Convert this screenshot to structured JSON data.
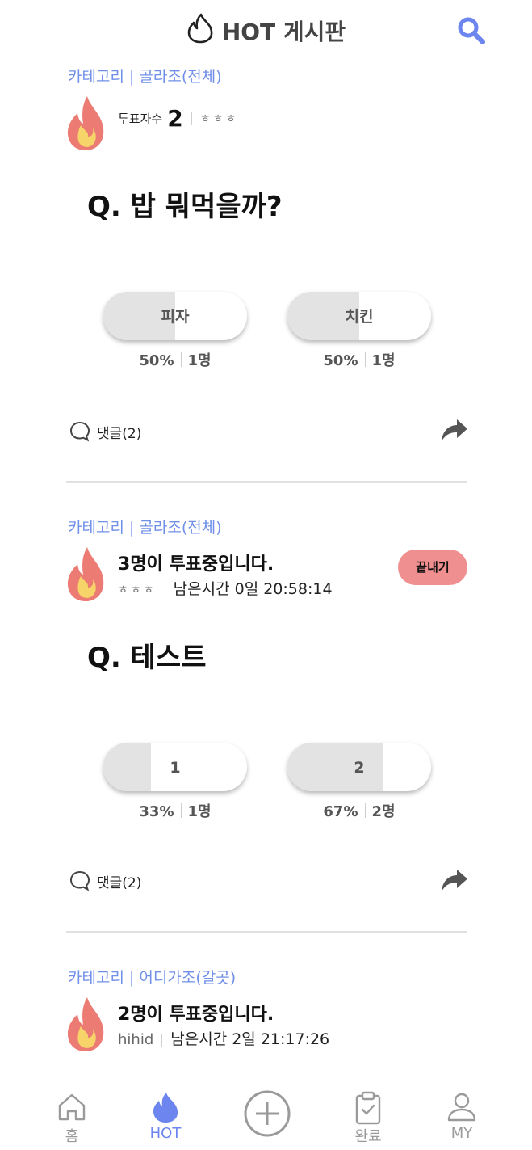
{
  "header": {
    "title": "HOT 게시판"
  },
  "posts": [
    {
      "category": "카테고리 | 골라조(전체)",
      "voter_label": "투표자수",
      "voter_count": "2",
      "author": "ㅎㅎㅎ",
      "question": "Q. 밥 뭐먹을까?",
      "options": [
        {
          "label": "피자",
          "percent": "50%",
          "count": "1명",
          "ratio": 0.5
        },
        {
          "label": "치킨",
          "percent": "50%",
          "count": "1명",
          "ratio": 0.5
        }
      ],
      "comments": "댓글(2)"
    },
    {
      "category": "카테고리 | 골라조(전체)",
      "status": "3명이 투표중입니다.",
      "author": "ㅎㅎㅎ",
      "time_left": "남은시간 0일 20:58:14",
      "end_button": "끝내기",
      "question": "Q. 테스트",
      "options": [
        {
          "label": "1",
          "percent": "33%",
          "count": "1명",
          "ratio": 0.33
        },
        {
          "label": "2",
          "percent": "67%",
          "count": "2명",
          "ratio": 0.67
        }
      ],
      "comments": "댓글(2)"
    },
    {
      "category": "카테고리 | 어디가조(갈곳)",
      "status": "2명이 투표중입니다.",
      "author": "hihid",
      "time_left": "남은시간 2일 21:17:26"
    }
  ],
  "nav": [
    {
      "label": "홈",
      "icon": "home-icon"
    },
    {
      "label": "HOT",
      "icon": "flame-icon"
    },
    {
      "label": "",
      "icon": "add-circle-icon"
    },
    {
      "label": "완료",
      "icon": "clipboard-check-icon"
    },
    {
      "label": "MY",
      "icon": "user-icon"
    }
  ],
  "colors": {
    "accent": "#6f8fe8",
    "end_button": "#f08f8f",
    "flame_outer": "#ec7b74",
    "flame_inner": "#f7d46a"
  }
}
